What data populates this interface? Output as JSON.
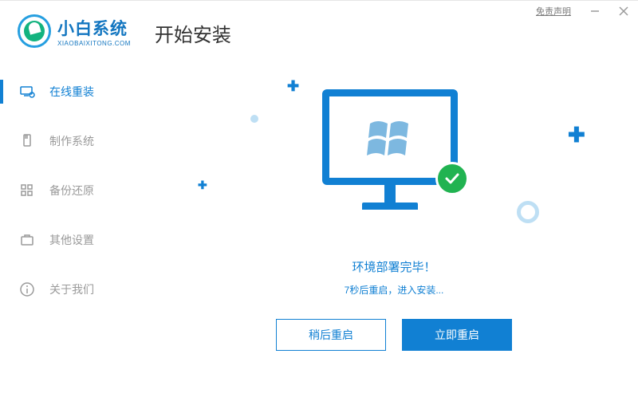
{
  "titlebar": {
    "disclaimer": "免责声明"
  },
  "logo": {
    "name": "小白系统",
    "url": "XIAOBAIXITONG.COM"
  },
  "page_title": "开始安装",
  "sidebar": [
    {
      "label": "在线重装",
      "active": true,
      "name": "nav-online-reinstall"
    },
    {
      "label": "制作系统",
      "active": false,
      "name": "nav-make-system"
    },
    {
      "label": "备份还原",
      "active": false,
      "name": "nav-backup-restore"
    },
    {
      "label": "其他设置",
      "active": false,
      "name": "nav-other-settings"
    },
    {
      "label": "关于我们",
      "active": false,
      "name": "nav-about-us"
    }
  ],
  "status": {
    "main": "环境部署完毕！",
    "sub": "7秒后重启，进入安装..."
  },
  "buttons": {
    "later": "稍后重启",
    "now": "立即重启"
  }
}
